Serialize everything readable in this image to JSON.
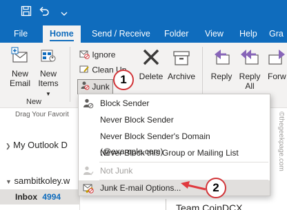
{
  "ribbon_tabs": [
    "File",
    "Home",
    "Send / Receive",
    "Folder",
    "View",
    "Help"
  ],
  "active_tab": "Home",
  "ribbon_overflow_tab": "Gra",
  "new_group": {
    "new_email_line1": "New",
    "new_email_line2": "Email",
    "new_items_line1": "New",
    "new_items_line2": "Items",
    "label": "New"
  },
  "delete_group": {
    "ignore": "Ignore",
    "clean_up": "Clean Up",
    "junk": "Junk",
    "delete": "Delete",
    "archive": "Archive"
  },
  "respond_group": {
    "reply": "Reply",
    "reply_all_line1": "Reply",
    "reply_all_line2": "All",
    "forward": "Forw"
  },
  "folder_pane": {
    "favorites_hint": "Drag Your Favorit",
    "my_outlook": "My Outlook D",
    "account": "sambitkoley.w",
    "inbox_label": "Inbox",
    "inbox_count": "4994"
  },
  "message_preview_sender": "Team CoinDCX",
  "junk_menu": {
    "items": [
      "Block Sender",
      "Never Block Sender",
      "Never Block Sender's Domain (@example.com)",
      "Never Block this Group or Mailing List",
      "Not Junk",
      "Junk E-mail Options..."
    ]
  },
  "callouts": [
    "1",
    "2"
  ],
  "watermark": "©thegeekpage.com",
  "colors": {
    "accent": "#0f6cbd",
    "ribbon_bg": "#f3f2f1",
    "callout_border": "#d13438",
    "arrow": "#e0393e"
  }
}
